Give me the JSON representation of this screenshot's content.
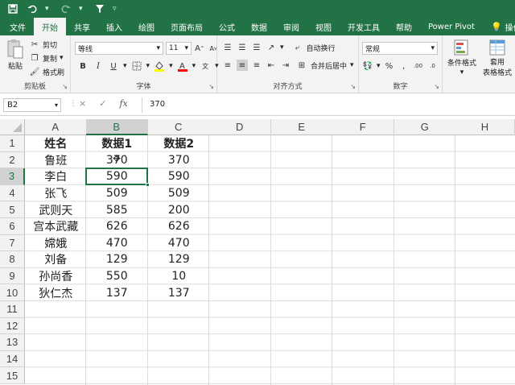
{
  "qat": {
    "save_icon": "save-icon",
    "undo_icon": "undo-icon",
    "redo_icon": "redo-icon",
    "filter_icon": "filter-icon"
  },
  "tabs": [
    "文件",
    "开始",
    "共享",
    "插入",
    "绘图",
    "页面布局",
    "公式",
    "数据",
    "审阅",
    "视图",
    "开发工具",
    "帮助",
    "Power Pivot",
    "操作说明搜索"
  ],
  "ribbon": {
    "clipboard": {
      "paste": "粘贴",
      "cut": "剪切",
      "copy": "复制",
      "format_painter": "格式刷",
      "label": "剪贴板"
    },
    "font": {
      "name": "等线",
      "size": "11",
      "bold": "B",
      "italic": "I",
      "underline": "U",
      "grow": "A",
      "shrink": "A",
      "label": "字体"
    },
    "alignment": {
      "wrap": "自动换行",
      "merge": "合并后居中",
      "label": "对齐方式"
    },
    "number": {
      "format": "常规",
      "percent": "%",
      "comma": ",",
      "label": "数字"
    },
    "styles": {
      "conditional": "条件格式",
      "table_line1": "套用",
      "table_line2": "表格格式"
    }
  },
  "formula_bar": {
    "name_box": "B2",
    "cancel": "×",
    "enter": "✓",
    "fx": "fx",
    "value": "370"
  },
  "columns": [
    "A",
    "B",
    "C",
    "D",
    "E",
    "F",
    "G",
    "H"
  ],
  "rows": [
    "1",
    "2",
    "3",
    "4",
    "5",
    "6",
    "7",
    "8",
    "9",
    "10",
    "11",
    "12",
    "13",
    "14",
    "15"
  ],
  "table": {
    "headers": [
      "姓名",
      "数据1",
      "数据2"
    ],
    "names": [
      "鲁班",
      "李白",
      "张飞",
      "武则天",
      "宫本武藏",
      "嫦娥",
      "刘备",
      "孙尚香",
      "狄仁杰"
    ],
    "data1": [
      "370",
      "590",
      "509",
      "585",
      "626",
      "470",
      "129",
      "550",
      "137"
    ],
    "data2": [
      "370",
      "590",
      "509",
      "200",
      "626",
      "470",
      "129",
      "10",
      "137"
    ]
  },
  "selection": {
    "cell": "B3",
    "selected_column": "B",
    "selected_row": "3"
  }
}
